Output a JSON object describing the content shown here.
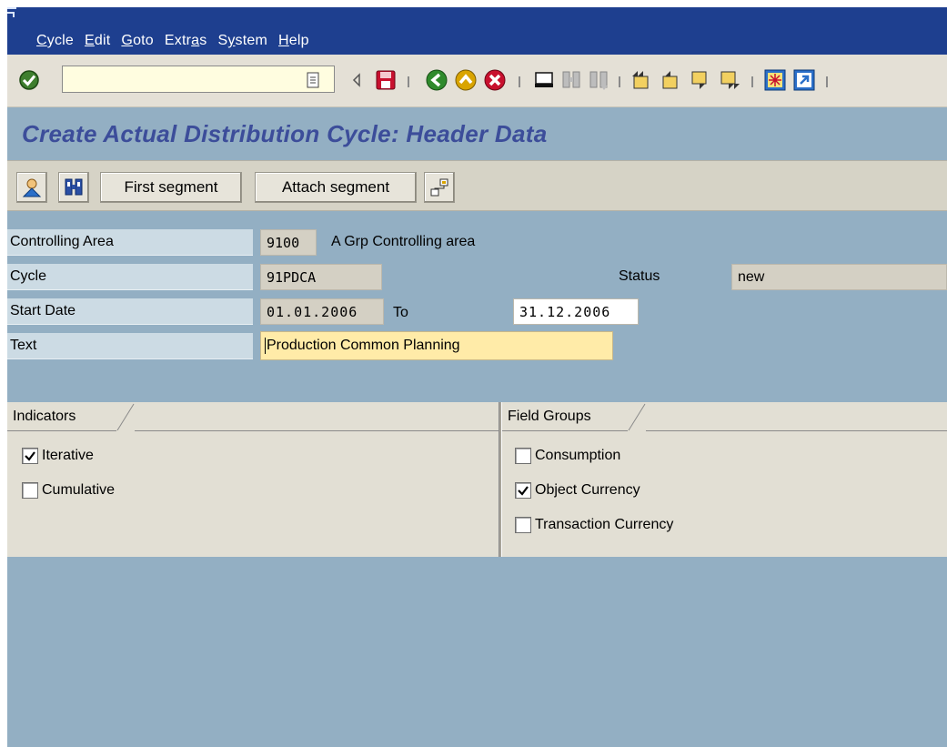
{
  "menu": {
    "items": [
      {
        "mnemonic": "C",
        "rest": "ycle"
      },
      {
        "mnemonic": "E",
        "rest": "dit"
      },
      {
        "mnemonic": "G",
        "rest": "oto"
      },
      {
        "pre": "Extr",
        "mnemonic": "a",
        "rest": "s"
      },
      {
        "pre": "S",
        "mnemonic": "y",
        "rest": "stem"
      },
      {
        "mnemonic": "H",
        "rest": "elp"
      }
    ]
  },
  "toolbar": {
    "command_value": "",
    "icons": [
      "enter-icon",
      "save-icon",
      "back-icon",
      "exit-icon",
      "cancel-icon",
      "print-icon",
      "find-icon",
      "find-next-icon",
      "first-page-icon",
      "previous-page-icon",
      "next-page-icon",
      "last-page-icon",
      "create-session-icon",
      "shortcut-icon"
    ]
  },
  "page": {
    "title": "Create Actual Distribution Cycle: Header Data"
  },
  "app_toolbar": {
    "first_segment": "First segment",
    "attach_segment": "Attach segment"
  },
  "header": {
    "controlling_area_label": "Controlling Area",
    "controlling_area_value": "9100",
    "controlling_area_desc": "A Grp Controlling area",
    "cycle_label": "Cycle",
    "cycle_value": "91PDCA",
    "status_label": "Status",
    "status_value": "new",
    "start_date_label": "Start Date",
    "start_date_value": "01.01.2006",
    "to_label": "To",
    "end_date_value": "31.12.2006",
    "text_label": "Text",
    "text_value": "Production Common Planning"
  },
  "indicators": {
    "title": "Indicators",
    "items": [
      {
        "label": "Iterative",
        "checked": true
      },
      {
        "label": "Cumulative",
        "checked": false
      }
    ]
  },
  "field_groups": {
    "title": "Field Groups",
    "items": [
      {
        "label": "Consumption",
        "checked": false
      },
      {
        "label": "Object Currency",
        "checked": true
      },
      {
        "label": "Transaction Currency",
        "checked": false
      }
    ]
  },
  "colors": {
    "menubar": "#1e3f8f",
    "background": "#93afc3",
    "title": "#3c4d9a",
    "input_highlight": "#ffeba8"
  }
}
